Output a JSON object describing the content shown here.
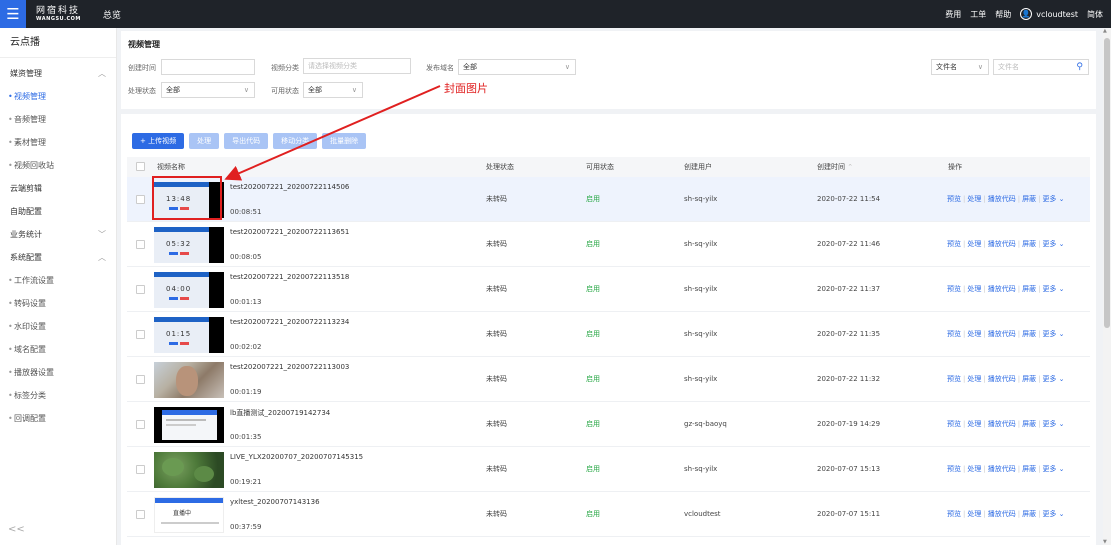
{
  "topbar": {
    "logo_cn": "网宿科技",
    "logo_en": "WANGSU.COM",
    "title": "总览",
    "links": [
      "费用",
      "工单",
      "帮助"
    ],
    "username": "vcloudtest",
    "lang": "简体"
  },
  "sidebar": {
    "header": "云点播",
    "items": [
      {
        "label": "媒资管理",
        "type": "group"
      },
      {
        "label": "视频管理",
        "type": "sub",
        "active": true
      },
      {
        "label": "音频管理",
        "type": "sub"
      },
      {
        "label": "素材管理",
        "type": "sub"
      },
      {
        "label": "视频回收站",
        "type": "sub"
      },
      {
        "label": "云端剪辑",
        "type": "top"
      },
      {
        "label": "自助配置",
        "type": "top"
      },
      {
        "label": "业务统计",
        "type": "group-collapsed"
      },
      {
        "label": "系统配置",
        "type": "group"
      },
      {
        "label": "工作流设置",
        "type": "sub"
      },
      {
        "label": "转码设置",
        "type": "sub"
      },
      {
        "label": "水印设置",
        "type": "sub"
      },
      {
        "label": "域名配置",
        "type": "sub"
      },
      {
        "label": "播放器设置",
        "type": "sub"
      },
      {
        "label": "标签分类",
        "type": "sub"
      },
      {
        "label": "回调配置",
        "type": "sub"
      }
    ],
    "collapse_glyph": "<<"
  },
  "filter": {
    "page_title": "视频管理",
    "create_time_label": "创建时间",
    "category_label": "视频分类",
    "category_placeholder": "请选择视频分类",
    "domain_label": "发布域名",
    "domain_value": "全部",
    "process_label": "处理状态",
    "process_value": "全部",
    "avail_label": "可用状态",
    "avail_value": "全部",
    "search_field": "文件名",
    "search_placeholder": "文件名"
  },
  "toolbar": {
    "upload": "+ 上传视频",
    "process": "处理",
    "export": "导出代码",
    "move": "移动分类",
    "batch_delete": "批量删除"
  },
  "table": {
    "columns": [
      "视频名称",
      "处理状态",
      "可用状态",
      "创建用户",
      "创建时间",
      "操作"
    ],
    "sort_glyph": "⌃",
    "op_labels": [
      "预览",
      "处理",
      "播放代码",
      "屏蔽",
      "更多"
    ],
    "rows": [
      {
        "name": "test202007221_20200722114506",
        "duration": "00:08:51",
        "status": "未转码",
        "avail": "启用",
        "user": "sh-sq-yilx",
        "time": "2020-07-22 11:54",
        "thumb": "blue",
        "thumb_text": "13:48"
      },
      {
        "name": "test202007221_20200722113651",
        "duration": "00:08:05",
        "status": "未转码",
        "avail": "启用",
        "user": "sh-sq-yilx",
        "time": "2020-07-22 11:46",
        "thumb": "blue",
        "thumb_text": "05:32"
      },
      {
        "name": "test202007221_20200722113518",
        "duration": "00:01:13",
        "status": "未转码",
        "avail": "启用",
        "user": "sh-sq-yilx",
        "time": "2020-07-22 11:37",
        "thumb": "blue",
        "thumb_text": "04:00"
      },
      {
        "name": "test202007221_20200722113234",
        "duration": "00:02:02",
        "status": "未转码",
        "avail": "启用",
        "user": "sh-sq-yilx",
        "time": "2020-07-22 11:35",
        "thumb": "blue",
        "thumb_text": "01:15"
      },
      {
        "name": "test202007221_20200722113003",
        "duration": "00:01:19",
        "status": "未转码",
        "avail": "启用",
        "user": "sh-sq-yilx",
        "time": "2020-07-22 11:32",
        "thumb": "face",
        "thumb_text": ""
      },
      {
        "name": "lb直播测试_20200719142734",
        "duration": "00:01:35",
        "status": "未转码",
        "avail": "启用",
        "user": "gz-sq-baoyq",
        "time": "2020-07-19 14:29",
        "thumb": "screen",
        "thumb_text": ""
      },
      {
        "name": "LIVE_YLX20200707_20200707145315",
        "duration": "00:19:21",
        "status": "未转码",
        "avail": "启用",
        "user": "sh-sq-yilx",
        "time": "2020-07-07 15:13",
        "thumb": "leaf",
        "thumb_text": ""
      },
      {
        "name": "yxltest_20200707143136",
        "duration": "00:37:59",
        "status": "未转码",
        "avail": "启用",
        "user": "vcloudtest",
        "time": "2020-07-07 15:11",
        "thumb": "web",
        "thumb_text": "直播中"
      }
    ]
  },
  "annotation": {
    "label": "封面图片"
  },
  "colors": {
    "accent": "#2d6be4",
    "topbar": "#1f2329",
    "annotation": "#e02020",
    "enabled": "#27a745"
  }
}
